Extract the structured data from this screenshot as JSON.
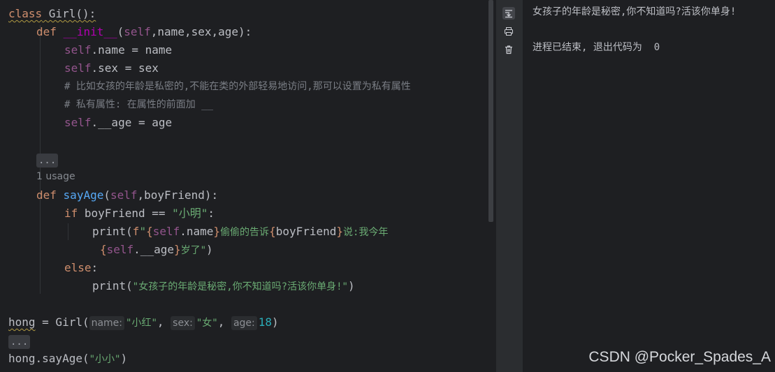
{
  "editor": {
    "lines": [
      {
        "parts": [
          [
            "kw",
            "class"
          ],
          [
            "",
            "Girl"
          ],
          [
            "",
            "():"
          ]
        ]
      },
      {
        "parts": [
          [
            "kw",
            "def"
          ],
          [
            "",
            "__init__"
          ],
          [
            "",
            ""
          ]
        ]
      }
    ],
    "usage_hint": "1 usage",
    "code": {
      "l1_class": "class",
      "l1_name": " Girl():",
      "l2_def": "def",
      "l2_init": "__init__",
      "l2_paren_open": "(",
      "l2_self": "self",
      "l2_rest": ",name,sex,age):",
      "l3_self": "self",
      "l3_rest": ".name = name",
      "l4_self": "self",
      "l4_rest": ".sex = sex",
      "l5_comment": "# 比如女孩的年龄是私密的,不能在类的外部轻易地访问,那可以设置为私有属性",
      "l6_comment": "# 私有属性: 在属性的前面加 __",
      "l7_self": "self",
      "l7_rest": ".__age = age",
      "l8_fold": "...",
      "l9_def": "def",
      "l9_fn": "sayAge",
      "l9_paren_open": "(",
      "l9_self": "self",
      "l9_rest": ",boyFriend):",
      "l10_if": "if",
      "l10_rest": " boyFriend == ",
      "l10_str": "\"小明\"",
      "l10_colon": ":",
      "l11_print": "print(",
      "l11_f": "f",
      "l11_q": "\"",
      "l11_b1": "{",
      "l11_self": "self",
      "l11_name": ".name",
      "l11_b2": "}",
      "l11_txt": "偷偷的告诉",
      "l11_b3": "{",
      "l11_bf": "boyFriend",
      "l11_b4": "}",
      "l11_txt2": "说:我今年",
      "l12_b1": "{",
      "l12_self": "self",
      "l12_age": ".__age",
      "l12_b2": "}",
      "l12_txt": "岁了\"",
      "l12_close": ")",
      "l13_else": "else",
      "l13_colon": ":",
      "l14_print": "print(",
      "l14_str": "\"女孩子的年龄是秘密,你不知道吗?活该你单身!\"",
      "l14_close": ")",
      "l15_hong": "hong",
      "l15_eq": " = Girl(",
      "l15_hint_name": "name:",
      "l15_v1": "\"小红\"",
      "l15_c1": ",",
      "l15_hint_sex": "sex:",
      "l15_v2": "\"女\"",
      "l15_c2": ",",
      "l15_hint_age": "age:",
      "l15_v3": "18",
      "l15_close": ")",
      "l16_fold": "...",
      "l17_a": "hong.sayAge(",
      "l17_str": "\"小小\"",
      "l17_close": ")"
    }
  },
  "console": {
    "output_line": "女孩子的年龄是秘密,你不知道吗?活该你单身!",
    "exit_line": "进程已结束, 退出代码为  0"
  },
  "toolbar": {
    "icons": [
      "scroll-to-end-icon",
      "print-icon",
      "trash-icon"
    ]
  },
  "watermark": "CSDN @Pocker_Spades_A"
}
